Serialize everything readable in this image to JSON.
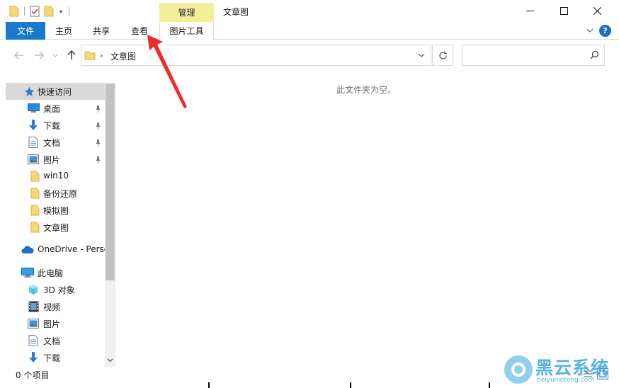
{
  "window": {
    "title": "文章图",
    "context_tab_header": "管理"
  },
  "quick_access_toolbar": {
    "icons": [
      "folder-icon",
      "properties-icon",
      "new-folder-icon"
    ],
    "caret": "▾"
  },
  "ribbon": {
    "tabs": [
      {
        "label": "文件"
      },
      {
        "label": "主页"
      },
      {
        "label": "共享"
      },
      {
        "label": "查看"
      },
      {
        "label": "图片工具"
      }
    ],
    "help": "?"
  },
  "address": {
    "separator": "›",
    "path": "文章图"
  },
  "search": {
    "placeholder": ""
  },
  "nav_pane": {
    "items": [
      {
        "label": "快速访问",
        "icon": "star-icon"
      },
      {
        "label": "桌面",
        "icon": "desktop-icon"
      },
      {
        "label": "下载",
        "icon": "download-icon"
      },
      {
        "label": "文档",
        "icon": "document-icon"
      },
      {
        "label": "图片",
        "icon": "pictures-icon"
      },
      {
        "label": "win10",
        "icon": "folder-icon"
      },
      {
        "label": "备份还原",
        "icon": "folder-icon"
      },
      {
        "label": "模拟图",
        "icon": "folder-icon"
      },
      {
        "label": "文章图",
        "icon": "folder-icon"
      },
      {
        "label": "OneDrive - Perso",
        "icon": "cloud-icon"
      },
      {
        "label": "此电脑",
        "icon": "computer-icon"
      },
      {
        "label": "3D 对象",
        "icon": "cube-icon"
      },
      {
        "label": "视频",
        "icon": "video-icon"
      },
      {
        "label": "图片",
        "icon": "pictures-icon"
      },
      {
        "label": "文档",
        "icon": "document-icon"
      },
      {
        "label": "下载",
        "icon": "download-icon"
      }
    ]
  },
  "content": {
    "empty_message": "此文件夹为空。"
  },
  "status": {
    "item_count": "0 个项目"
  },
  "watermark": {
    "brand": "黑云系统",
    "site": "heiyunxitong.com"
  },
  "colors": {
    "file_tab": "#1979ca",
    "context_tab": "#f2ee9a",
    "annotation_arrow": "#ee2b24",
    "selection": "#d9d9d9",
    "folder": "#f8d775"
  }
}
